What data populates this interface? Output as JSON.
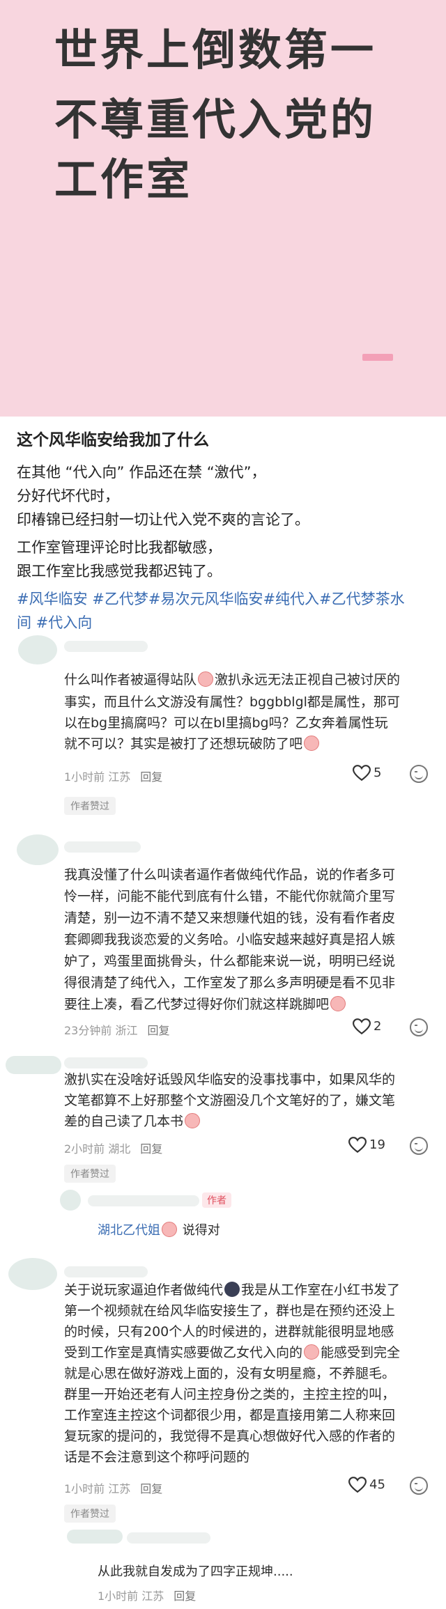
{
  "cover": {
    "line1": "世界上倒数第一",
    "line2": "不尊重代入党的",
    "line3": "工作室"
  },
  "post": {
    "title": "这个风华临安给我加了什么",
    "lines": [
      "在其他 “代入向” 作品还在禁 “激代”，",
      "分好代坏代时，",
      "印椿锦已经扫射一切让代入党不爽的言论了。",
      "工作室管理评论时比我都敏感，",
      "跟工作室比我感觉我都迟钝了。"
    ],
    "tags_line1": "#风华临安 #乙代梦#易次元风华临安#纯代入#乙代梦茶水",
    "tags_line2": "间 #代入向"
  },
  "comments": [
    {
      "lines": [
        "什么叫作者被逼得站队",
        "激扒永远无法正视自己被讨厌的",
        "事实，而且什么文游没有属性？bggbblgl都是属性，那可",
        "以在bg里搞腐吗？可以在bl里搞bg吗？乙女奔着属性玩",
        "就不可以？其实是被打了还想玩破防了吧"
      ],
      "time": "1小时前 江苏",
      "reply": "回复",
      "likes": "5",
      "badge": "作者赞过"
    },
    {
      "lines": [
        "我真没懂了什么叫读者逼作者做纯代作品，说的作者多可",
        "怜一样，问能不能代到底有什么错，不能代你就简介里写",
        "清楚，别一边不清不楚又来想赚代姐的钱，没有看作者皮",
        "套卿卿我我谈恋爱的义务哈。小临安越来越好真是招人嫉",
        "妒了，鸡蛋里面挑骨头，什么都能来说一说，明明已经说",
        "得很清楚了纯代入，工作室发了那么多声明硬是看不见非",
        "要往上凑，看乙代梦过得好你们就这样跳脚吧"
      ],
      "time": "23分钟前 浙江",
      "reply": "回复",
      "likes": "2"
    },
    {
      "lines": [
        "激扒实在没啥好诋毁风华临安的没事找事中，如果风华的",
        "文笔都算不上好那整个文游圈没几个文笔好的了，嫌文笔",
        "差的自己读了几本书"
      ],
      "time": "2小时前 湖北",
      "reply": "回复",
      "likes": "19",
      "badge": "作者赞过",
      "author_tag": "作者",
      "reply_name": "湖北乙代姐",
      "reply_text": " 说得对"
    },
    {
      "lines": [
        "关于说玩家逼迫作者做纯代",
        "我是从工作室在小红书发了",
        "第一个视频就在给风华临安接生了，群也是在预约还没上",
        "的时候，只有200个人的时候进的，进群就能很明显地感",
        "受到工作室是真情实感要做乙女代入向的",
        "能感受到完全",
        "就是心思在做好游戏上面的，没有女明星瘾，不养腿毛。",
        "群里一开始还老有人问主控身份之类的，主控主控的叫，",
        "工作室连主控这个词都很少用，都是直接用第二人称来回",
        "复玩家的提问的，我觉得不是真心想做好代入感的作者的",
        "话是不会注意到这个称呼问题的"
      ],
      "time": "1小时前 江苏",
      "reply": "回复",
      "likes": "45",
      "badge": "作者赞过",
      "reply_text": "从此我就自发成为了四字正规坤....."
    }
  ],
  "last_meta": {
    "time": "1小时前 江苏",
    "reply": "回复"
  },
  "colors": {
    "cover_bg": "#f8d6df",
    "accent_pink": "#f3a0b7",
    "tag_blue": "#3b6db3",
    "author_red": "#e0505f"
  },
  "icons": [
    "heart-icon",
    "emoji-icon",
    "pig-emoji",
    "dark-face-emoji"
  ]
}
